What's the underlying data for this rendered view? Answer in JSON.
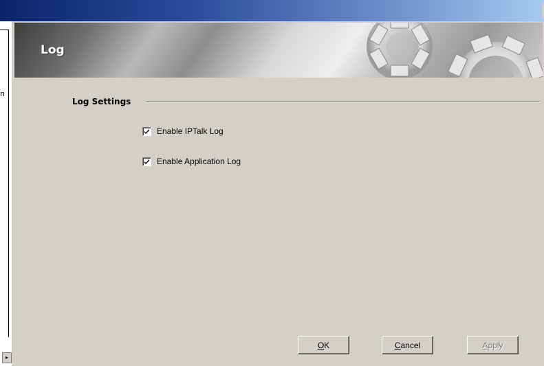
{
  "window": {
    "title": ""
  },
  "left_panel": {
    "fragment": "n",
    "scroll_glyph": "▸"
  },
  "banner": {
    "title": "Log"
  },
  "group": {
    "title": "Log Settings"
  },
  "options": [
    {
      "label": "Enable IPTalk Log",
      "checked": true
    },
    {
      "label": "Enable Application Log",
      "checked": true
    }
  ],
  "buttons": {
    "ok": {
      "mnemonic": "O",
      "rest": "K"
    },
    "cancel": {
      "mnemonic": "C",
      "rest": "ancel"
    },
    "apply": {
      "mnemonic": "A",
      "rest": "pply",
      "enabled": false
    }
  },
  "colors": {
    "dialog_bg": "#d4d0c8",
    "titlebar_start": "#0a246a",
    "titlebar_end": "#a6caf0",
    "disabled_text": "#808080"
  }
}
